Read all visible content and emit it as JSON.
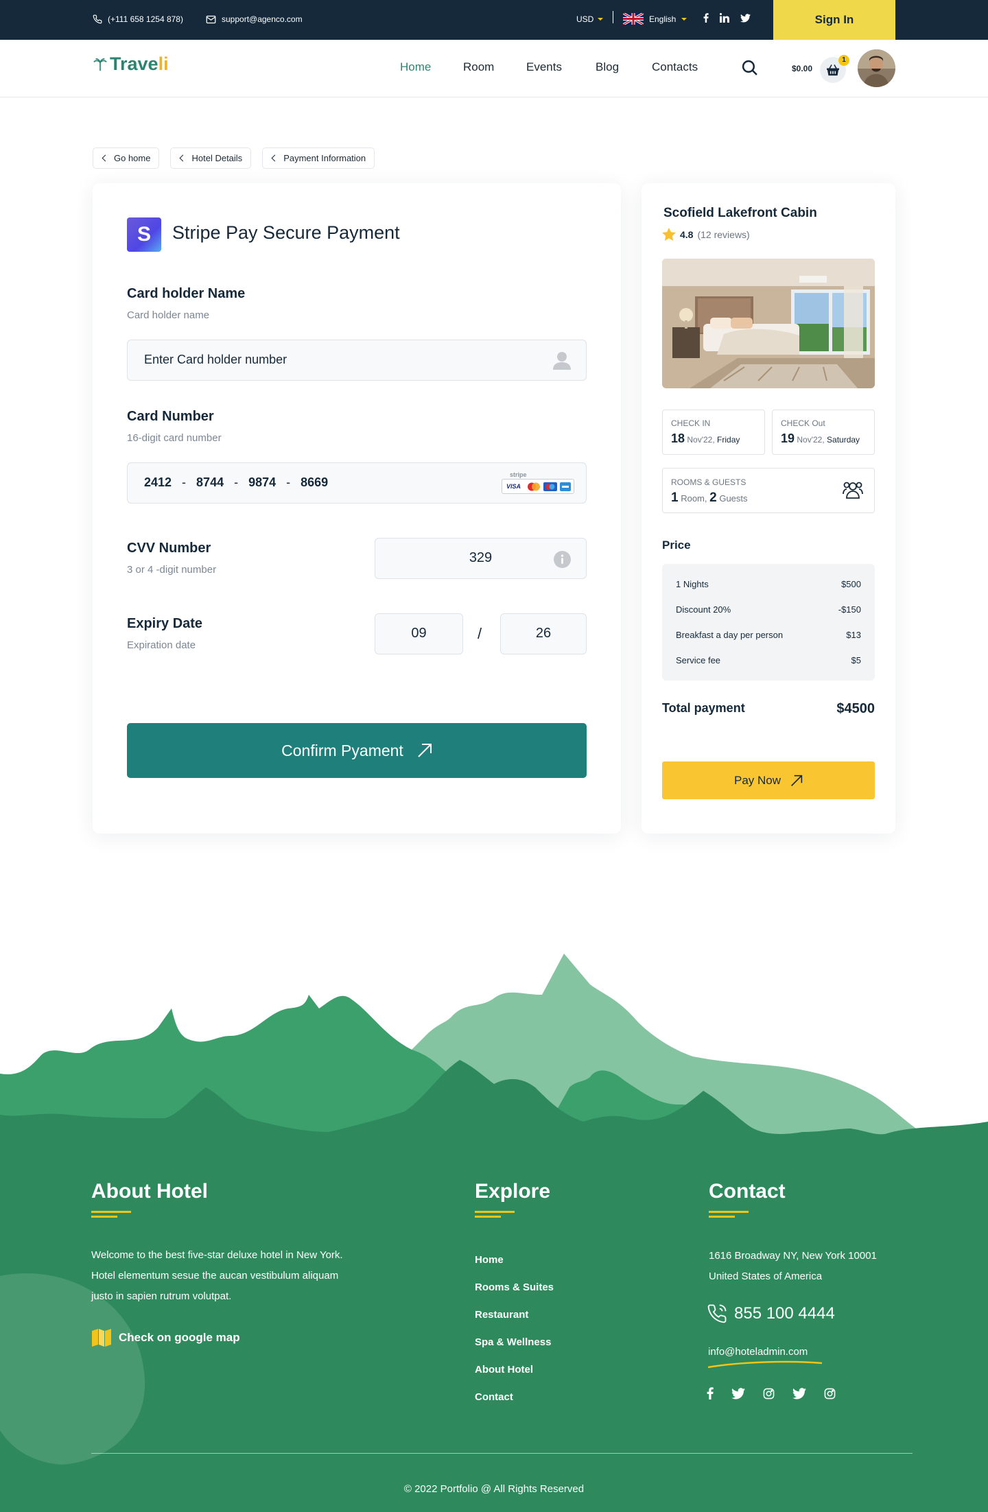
{
  "topbar": {
    "phone": "(+111 658 1254 878)",
    "email": "support@agenco.com",
    "currency": "USD",
    "language": "English",
    "signin_label": "Sign In",
    "accent_color": "#f0d84b",
    "background_color": "#15293a"
  },
  "header": {
    "logo_main": "Trave",
    "logo_accent": "li",
    "nav": [
      {
        "label": "Home",
        "active": true
      },
      {
        "label": "Room",
        "active": false
      },
      {
        "label": "Events",
        "active": false
      },
      {
        "label": "Blog",
        "active": false
      },
      {
        "label": "Contacts",
        "active": false
      }
    ],
    "cart_amount": "$0.00",
    "cart_count": "1"
  },
  "breadcrumb": [
    "Go home",
    "Hotel Details",
    "Payment Information"
  ],
  "payment": {
    "logo_letter": "S",
    "title": "Stripe Pay Secure Payment",
    "holder_label": "Card holder Name",
    "holder_sub": "Card holder name",
    "holder_placeholder": "Enter Card holder number",
    "card_label": "Card Number",
    "card_sub": "16-digit card number",
    "card_groups": [
      "2412",
      "8744",
      "9874",
      "8669"
    ],
    "card_separator": "-",
    "stripe_badge": "stripe",
    "cvv_label": "CVV Number",
    "cvv_sub": "3 or 4 -digit number",
    "cvv_value": "329",
    "expiry_label": "Expiry Date",
    "expiry_sub": "Expiration date",
    "expiry_month": "09",
    "expiry_separator": "/",
    "expiry_year": "26",
    "confirm_label": "Confirm Pyament",
    "button_color": "#1f7f7b"
  },
  "summary": {
    "hotel_name": "Scofield Lakefront Cabin",
    "rating": "4.8",
    "reviews": "(12 reviews)",
    "check_in_label": "CHECK IN",
    "check_in_day": "18",
    "check_in_rest": "Nov'22,",
    "check_in_weekday": "Friday",
    "check_out_label": "CHECK Out",
    "check_out_day": "19",
    "check_out_rest": "Nov'22,",
    "check_out_weekday": "Saturday",
    "rooms_label": "ROOMS & GUESTS",
    "rooms_count": "1",
    "rooms_word": "Room,",
    "guests_count": "2",
    "guests_word": "Guests",
    "price_title": "Price",
    "price_rows": [
      {
        "label": "1 Nights",
        "value": "$500"
      },
      {
        "label": "Discount 20%",
        "value": "-$150"
      },
      {
        "label": "Breakfast a day per person",
        "value": "$13"
      },
      {
        "label": "Service fee",
        "value": "$5"
      }
    ],
    "total_label": "Total payment",
    "total_value": "$4500",
    "pay_now_label": "Pay Now",
    "pay_color": "#f9c531"
  },
  "footer": {
    "about_title": "About Hotel",
    "about_text": "Welcome to the best five-star deluxe hotel in New York. Hotel elementum sesue the aucan vestibulum aliquam justo in sapien rutrum volutpat.",
    "map_link": "Check on google map",
    "explore_title": "Explore",
    "explore_links": [
      "Home",
      "Rooms & Suites",
      "Restaurant",
      "Spa & Wellness",
      "About Hotel",
      "Contact"
    ],
    "contact_title": "Contact",
    "address_line1": "1616 Broadway NY, New York 10001",
    "address_line2": "United States of America",
    "phone": "855 100 4444",
    "email": "info@hoteladmin.com",
    "copyright": "© 2022 Portfolio @ All Rights Reserved",
    "background_color": "#2e8a5c",
    "accent_color": "#f0c419"
  }
}
